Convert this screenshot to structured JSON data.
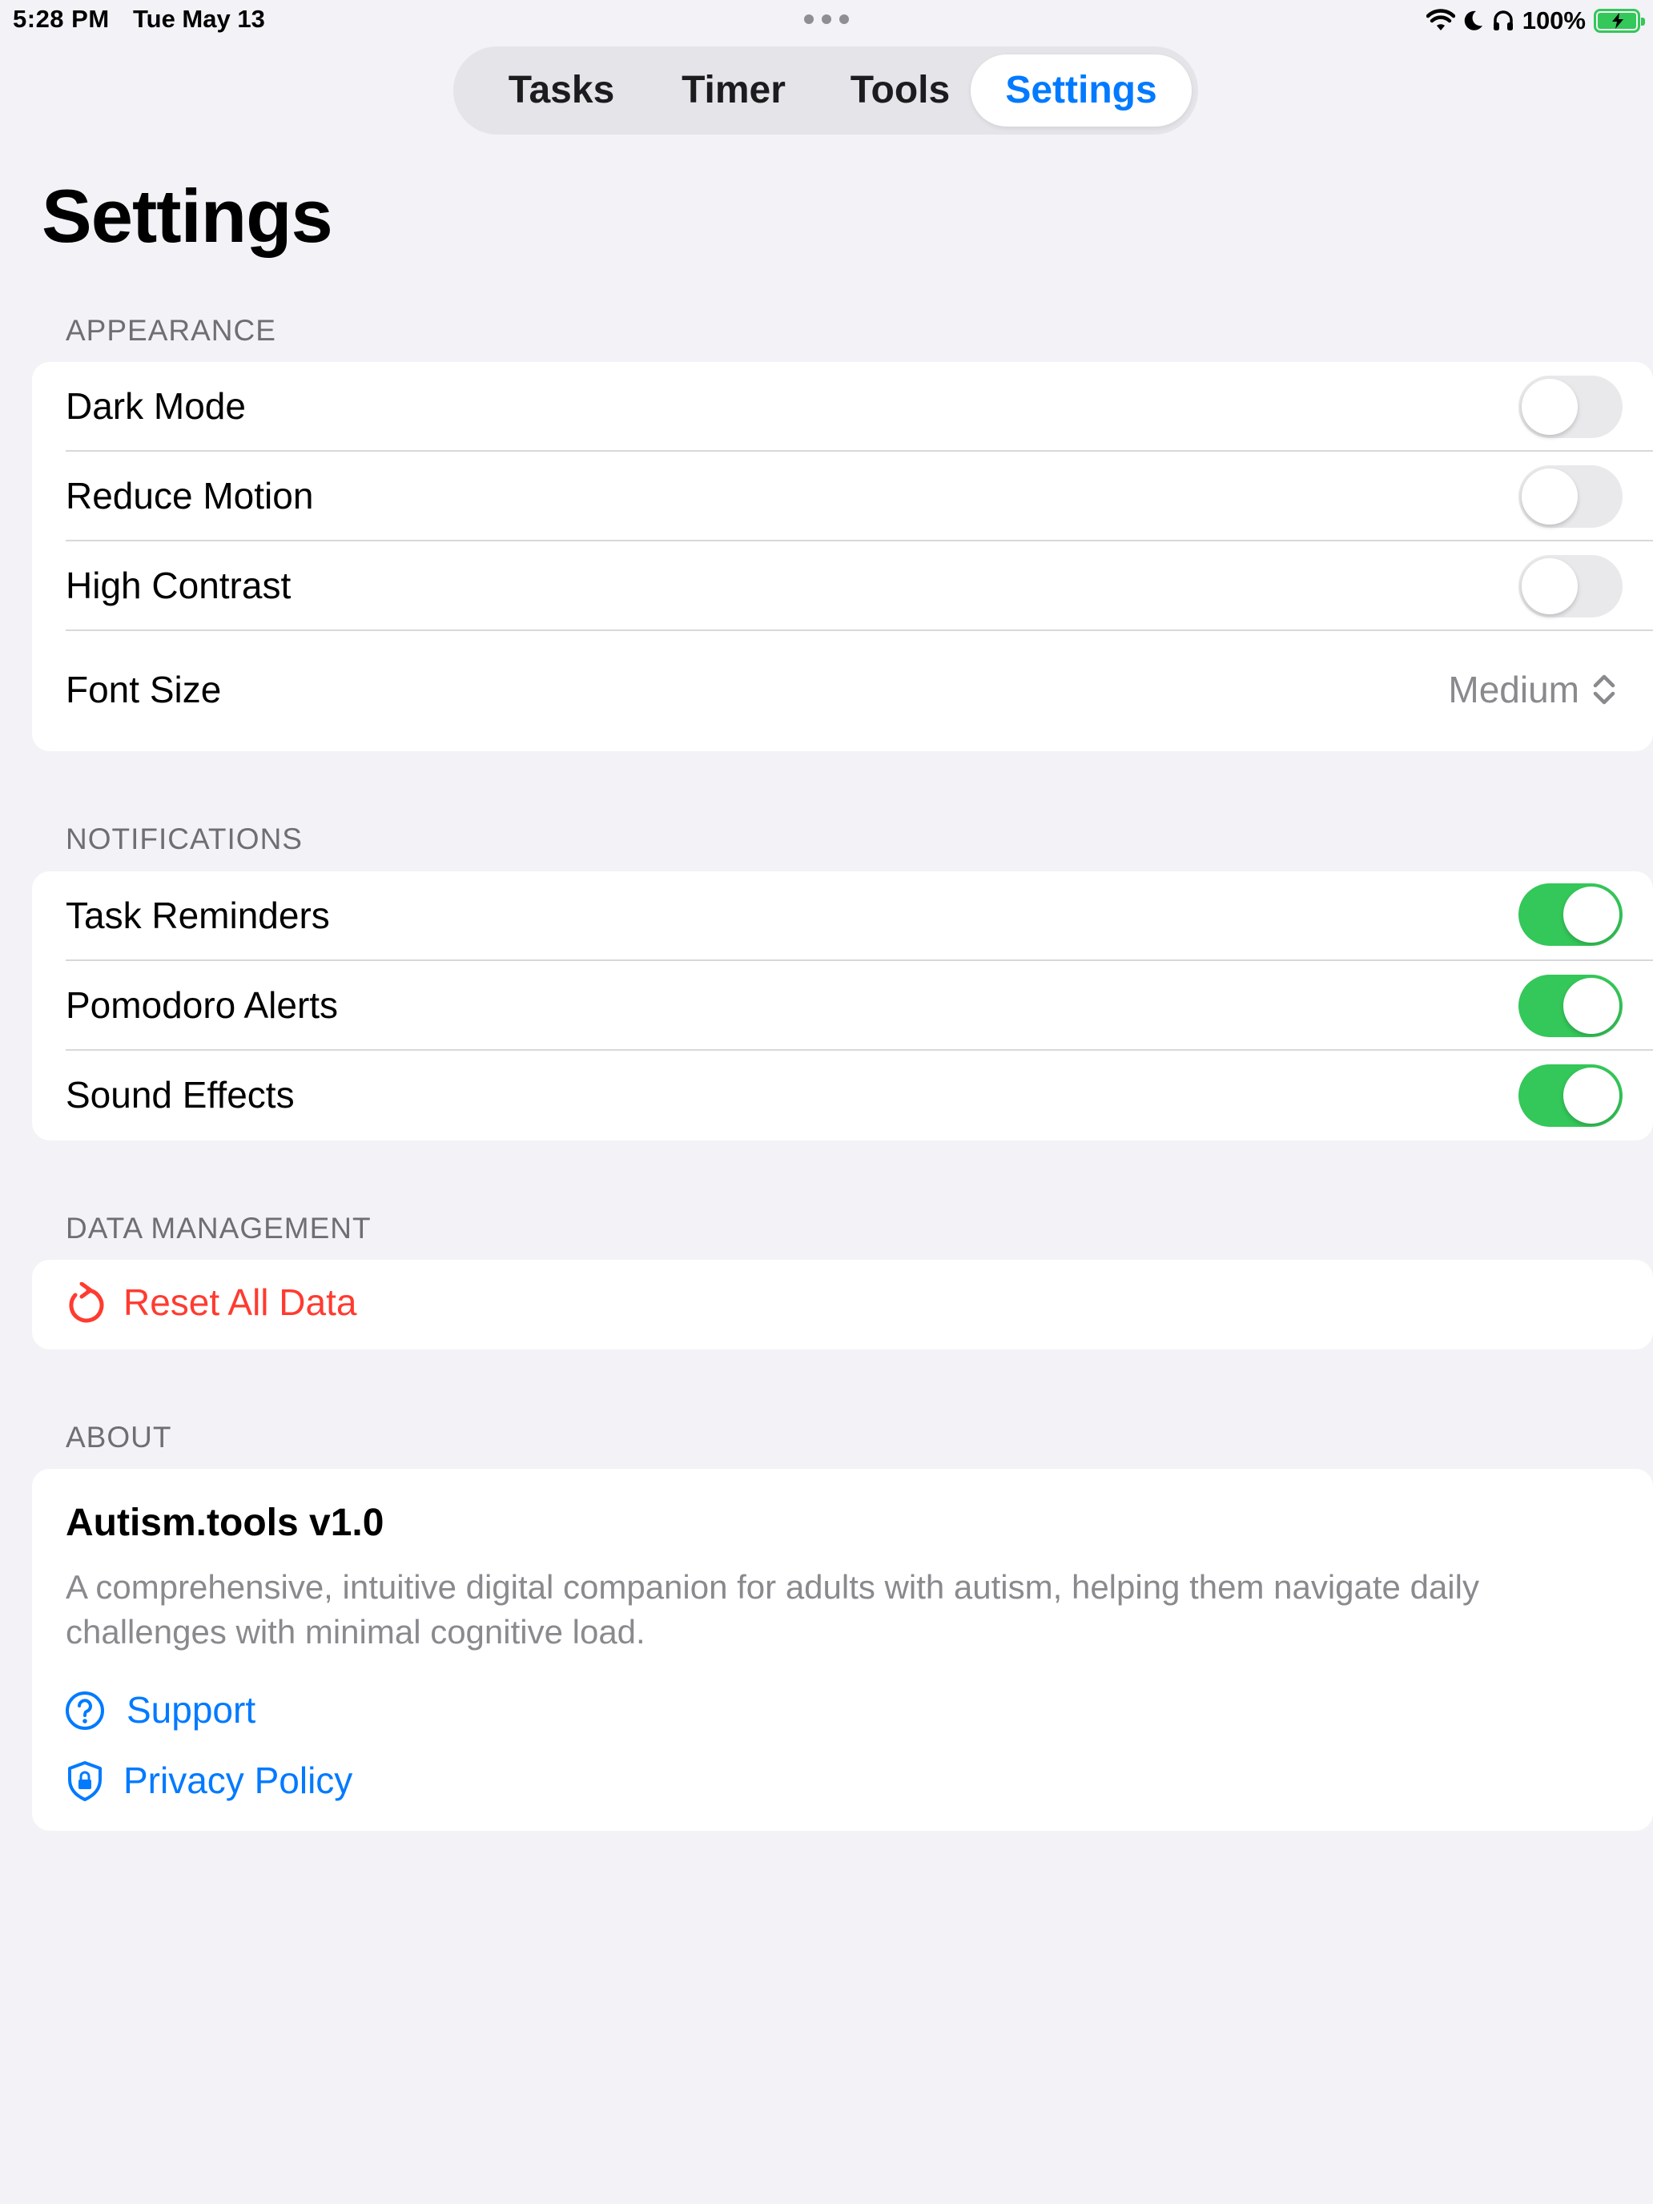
{
  "status_bar": {
    "time": "5:28 PM",
    "date": "Tue May 13",
    "battery_text": "100%"
  },
  "tabs": [
    {
      "label": "Tasks"
    },
    {
      "label": "Timer"
    },
    {
      "label": "Tools"
    },
    {
      "label": "Settings",
      "selected": true
    }
  ],
  "page": {
    "title": "Settings"
  },
  "appearance": {
    "header": "APPEARANCE",
    "dark_mode": {
      "label": "Dark Mode",
      "on": false
    },
    "reduce_motion": {
      "label": "Reduce Motion",
      "on": false
    },
    "high_contrast": {
      "label": "High Contrast",
      "on": false
    },
    "font_size": {
      "label": "Font Size",
      "value": "Medium"
    }
  },
  "notifications": {
    "header": "NOTIFICATIONS",
    "task_reminders": {
      "label": "Task Reminders",
      "on": true
    },
    "pomodoro_alerts": {
      "label": "Pomodoro Alerts",
      "on": true
    },
    "sound_effects": {
      "label": "Sound Effects",
      "on": true
    }
  },
  "data_management": {
    "header": "DATA MANAGEMENT",
    "reset_label": "Reset All Data"
  },
  "about": {
    "header": "ABOUT",
    "title": "Autism.tools v1.0",
    "description": "A comprehensive, intuitive digital companion for adults with autism, helping them navigate daily challenges with minimal cognitive load.",
    "support_label": "Support",
    "privacy_label": "Privacy Policy"
  },
  "colors": {
    "accent": "#007aff",
    "toggle_on": "#34c759",
    "destructive": "#ff3b30",
    "background": "#f2f2f7"
  },
  "icons": {
    "wifi": "wifi-icon",
    "focus": "moon-icon",
    "headphones": "headphones-icon",
    "battery": "battery-charging-icon",
    "reset": "arrow-counterclockwise-icon",
    "support": "question-circle-icon",
    "privacy": "lock-shield-icon",
    "chevron": "chevron-up-down-icon"
  }
}
